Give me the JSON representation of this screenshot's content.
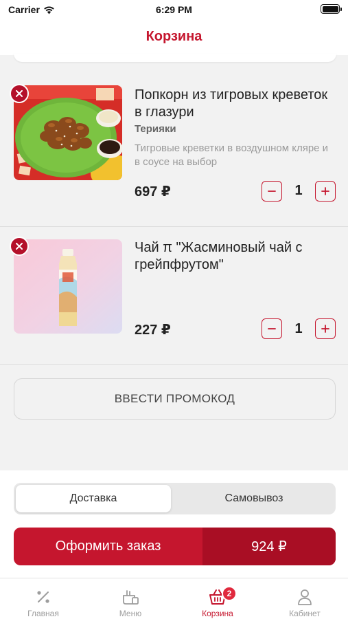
{
  "status_bar": {
    "carrier": "Carrier",
    "time": "6:29 PM"
  },
  "header": {
    "title": "Корзина"
  },
  "cart": {
    "items": [
      {
        "name": "Попкорн из тигровых креветок в глазури",
        "option": "Терияки",
        "description": "Тигровые креветки в воздушном кляре и в соусе на выбор",
        "price": "697 ₽",
        "quantity": "1"
      },
      {
        "name": "Чай π \"Жасминовый чай с грейпфрутом\"",
        "price": "227 ₽",
        "quantity": "1"
      }
    ]
  },
  "promo": {
    "label": "ВВЕСТИ ПРОМОКОД"
  },
  "delivery_toggle": {
    "options": [
      "Доставка",
      "Самовывоз"
    ],
    "selected": "Доставка"
  },
  "checkout": {
    "label": "Оформить заказ",
    "total": "924 ₽"
  },
  "tab_bar": {
    "tabs": [
      {
        "label": "Главная",
        "icon": "percent-icon"
      },
      {
        "label": "Меню",
        "icon": "menu-icon"
      },
      {
        "label": "Корзина",
        "icon": "basket-icon",
        "badge": "2",
        "active": true
      },
      {
        "label": "Кабинет",
        "icon": "profile-icon"
      }
    ]
  },
  "colors": {
    "accent": "#c5162e",
    "accent_dark": "#a90e24",
    "background": "#f2f2f2",
    "muted_text": "#9a9a9a"
  }
}
